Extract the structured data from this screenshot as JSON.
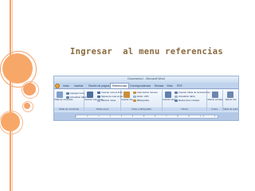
{
  "slide": {
    "heading": "Ingresar  al menu referencias"
  },
  "window": {
    "title": "Documento1 - Microsoft Word",
    "tabs": [
      "Inicio",
      "Insertar",
      "Diseño de página",
      "Referencias",
      "Correspondencia",
      "Revisar",
      "Vista",
      "PDF"
    ],
    "active_tab": "Referencias",
    "groups": [
      {
        "label": "Tabla de contenido",
        "large_button": "Tabla de contenido",
        "items": [
          "Agregar texto",
          "Actualizar tabla"
        ]
      },
      {
        "label": "Notas al pie",
        "large_button": "Insertar nota al pie",
        "items": [
          "Insertar nota al final",
          "Siguiente nota al pie",
          "Mostrar notas"
        ]
      },
      {
        "label": "Citas y bibliografía",
        "large_button": "Insertar cita",
        "items": [
          "Administrar fuentes",
          "Estilo: APA",
          "Bibliografía"
        ]
      },
      {
        "label": "Títulos",
        "large_button": "Insertar título",
        "items": [
          "Insertar Tabla de ilustraciones",
          "Actualizar tabla",
          "Referencia cruzada"
        ]
      },
      {
        "label": "Índice",
        "large_button": "Marcar entrada",
        "items": []
      },
      {
        "label": "Tabla de autoridades",
        "large_button": "Marcar cita",
        "items": []
      }
    ],
    "ruler_ticks": "1 · 2 · 1 · 2 · 3 · 4 · 5 · 6 · 7 · 8 · 9 · 10 · 11 · 12 · 13 · 14"
  },
  "colors": {
    "accent_orange": "#f7a869",
    "heading_color": "#8a6a3e",
    "ribbon_blue": "#d5e3f4"
  }
}
